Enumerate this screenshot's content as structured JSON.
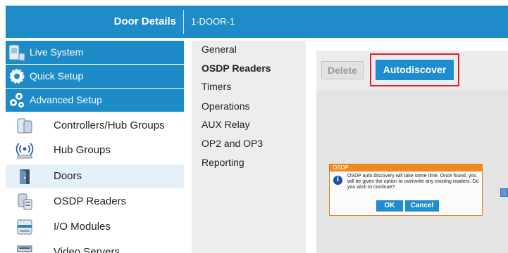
{
  "header": {
    "title": "Door Details",
    "door_name": "1-DOOR-1",
    "bg_color": "#1e8cc8"
  },
  "sidebar": {
    "main_items": [
      {
        "label": "Live System",
        "icon": "live-system-icon"
      },
      {
        "label": "Quick Setup",
        "icon": "gear-icon"
      },
      {
        "label": "Advanced Setup",
        "icon": "gears-icon"
      }
    ],
    "sub_items": [
      {
        "label": "Controllers/Hub Groups",
        "icon": "controller-icon"
      },
      {
        "label": "Hub Groups",
        "icon": "wireless-hub-icon"
      },
      {
        "label": "Doors",
        "icon": "door-icon",
        "active": true
      },
      {
        "label": "OSDP Readers",
        "icon": "card-reader-icon"
      },
      {
        "label": "I/O Modules",
        "icon": "io-module-icon"
      },
      {
        "label": "Video Servers",
        "icon": "video-server-icon"
      }
    ]
  },
  "submenu": {
    "items": [
      "General",
      "OSDP Readers",
      "Timers",
      "Operations",
      "AUX Relay",
      "OP2 and OP3",
      "Reporting"
    ],
    "active": "OSDP Readers"
  },
  "toolbar": {
    "delete_label": "Delete",
    "autodiscover_label": "Autodiscover",
    "highlight_color": "#e0212d"
  },
  "dialog": {
    "title": "OSDP",
    "message": "OSDP auto discovery will take some time. Once found, you will be given the option to overwrite any existing readers. Do you wish to continue?",
    "ok_label": "OK",
    "cancel_label": "Cancel",
    "icon": "info-icon"
  }
}
